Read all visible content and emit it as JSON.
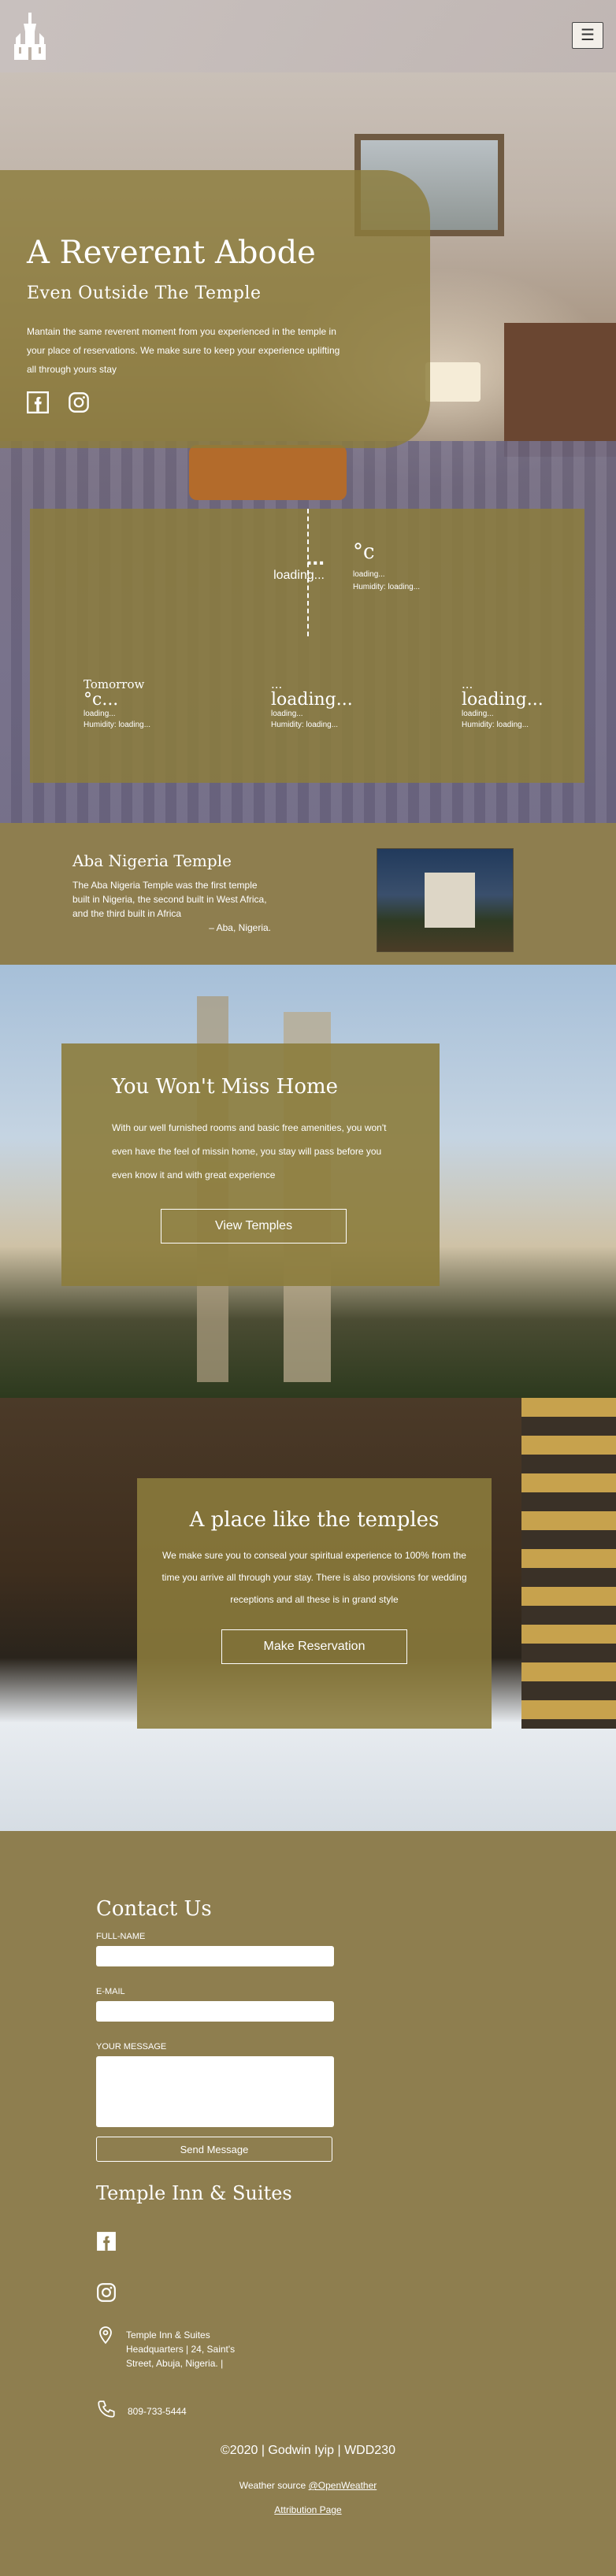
{
  "header": {
    "logo_icon": "temple-logo-icon",
    "menu_label": "☰"
  },
  "hero": {
    "title": "A Reverent Abode",
    "subtitle": "Even Outside The Temple",
    "description": "Mantain the same reverent moment from you experienced in the temple in your place of reservations. We make sure to keep your experience uplifting all through yours stay",
    "social_icons": [
      "facebook-icon",
      "instagram-icon"
    ]
  },
  "weather": {
    "current": {
      "description": "...",
      "description_sub": "loading...",
      "temp": "°c",
      "status": "loading...",
      "humidity": "Humidity: loading..."
    },
    "forecast": [
      {
        "day": "Tomorrow",
        "temp": "°c...",
        "status": "loading...",
        "humidity": "Humidity: loading..."
      },
      {
        "day": "...",
        "temp": "loading...",
        "status": "loading...",
        "humidity": "Humidity: loading..."
      },
      {
        "day": "...",
        "temp": "loading...",
        "status": "loading...",
        "humidity": "Humidity: loading..."
      }
    ]
  },
  "aba": {
    "title": "Aba Nigeria Temple",
    "text": "The Aba Nigeria Temple was the first temple built in Nigeria, the second built in West Africa, and the third built in Africa",
    "location": "– Aba, Nigeria."
  },
  "home": {
    "title": "You Won't Miss Home",
    "text": "With our well furnished rooms and basic free amenities, you won't even have the feel of missin home, you stay will pass before you even know it and with great experience",
    "button": "View Temples"
  },
  "place": {
    "title": "A place like the temples",
    "text": "We make sure you to conseal your spiritual experience to 100% from the time you arrive all through your stay. There is also provisions for wedding receptions and all these is in grand style",
    "button": "Make Reservation"
  },
  "contact": {
    "title": "Contact Us",
    "fullname_label": "FULL-NAME",
    "email_label": "E-MAIL",
    "message_label": "YOUR MESSAGE",
    "send_button": "Send Message"
  },
  "footer": {
    "brand": "Temple Inn & Suites",
    "social_icons": [
      "facebook-icon",
      "instagram-icon"
    ],
    "address": "Temple Inn & Suites Headquarters | 24, Saint's Street, Abuja, Nigeria. |",
    "phone": "809-733-5444",
    "copyright": "©2020 | Godwin Iyip | WDD230",
    "weather_source_prefix": "Weather source",
    "weather_source_link": "@OpenWeather",
    "attribution": "Attribution Page"
  },
  "colors": {
    "olive": "#8e7e4f",
    "card_overlay": "#8c7c3c"
  }
}
